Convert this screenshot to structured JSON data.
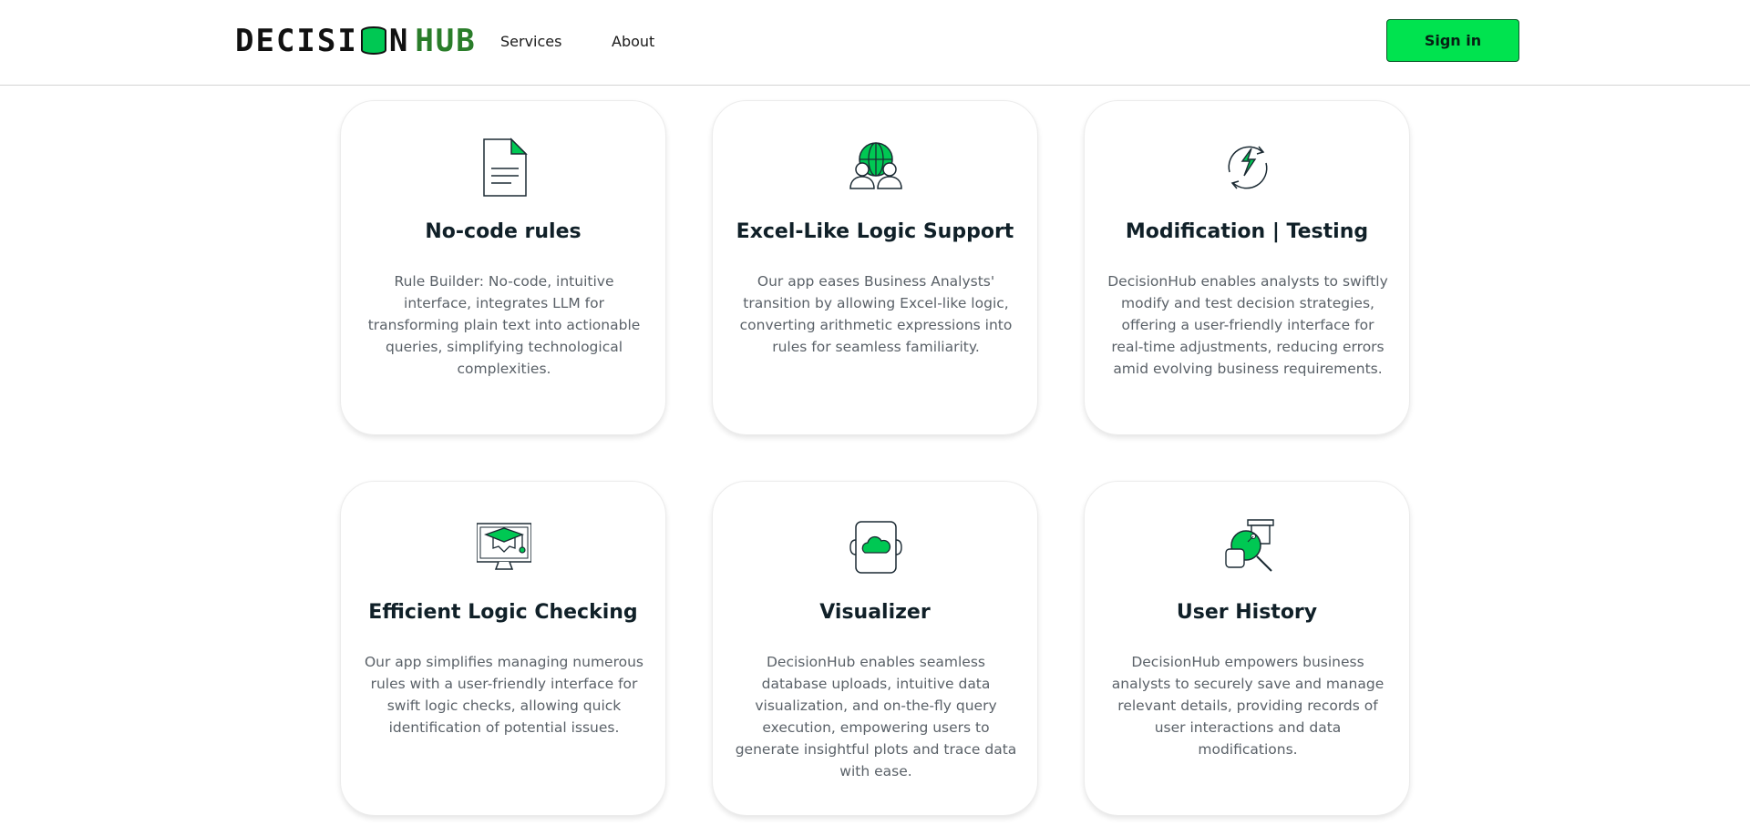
{
  "header": {
    "logo": {
      "part1": "DECISI",
      "part2": "N",
      "part3": "HUB",
      "icon": "database-icon"
    },
    "nav": [
      {
        "label": "Services"
      },
      {
        "label": "About"
      }
    ],
    "signin_label": "Sign in"
  },
  "colors": {
    "accent": "#00e34f",
    "logo_green": "#2a7d2a",
    "text_dark": "#102028",
    "text_muted": "#5a6168"
  },
  "cards": [
    {
      "icon": "document-icon",
      "title": "No-code rules",
      "description": "Rule Builder: No-code, intuitive interface, integrates LLM for transforming plain text into actionable queries, simplifying technological complexities."
    },
    {
      "icon": "globe-users-icon",
      "title": "Excel-Like Logic Support",
      "description": "Our app eases Business Analysts' transition by allowing Excel-like logic, converting arithmetic expressions into rules for seamless familiarity."
    },
    {
      "icon": "refresh-lightning-icon",
      "title": "Modification | Testing",
      "description": "DecisionHub enables analysts to swiftly modify and test decision strategies, offering a user-friendly interface for real-time adjustments, reducing errors amid evolving business requirements."
    },
    {
      "icon": "monitor-graduation-icon",
      "title": "Efficient Logic Checking",
      "description": "Our app simplifies managing numerous rules with a user-friendly interface for swift logic checks, allowing quick identification of potential issues."
    },
    {
      "icon": "cloud-brackets-icon",
      "title": "Visualizer",
      "description": "DecisionHub enables seamless database uploads, intuitive data visualization, and on-the-fly query execution, empowering users to generate insightful plots and trace data with ease."
    },
    {
      "icon": "search-history-icon",
      "title": "User History",
      "description": "DecisionHub empowers business analysts to securely save and manage relevant details, providing records of user interactions and data modifications."
    }
  ]
}
